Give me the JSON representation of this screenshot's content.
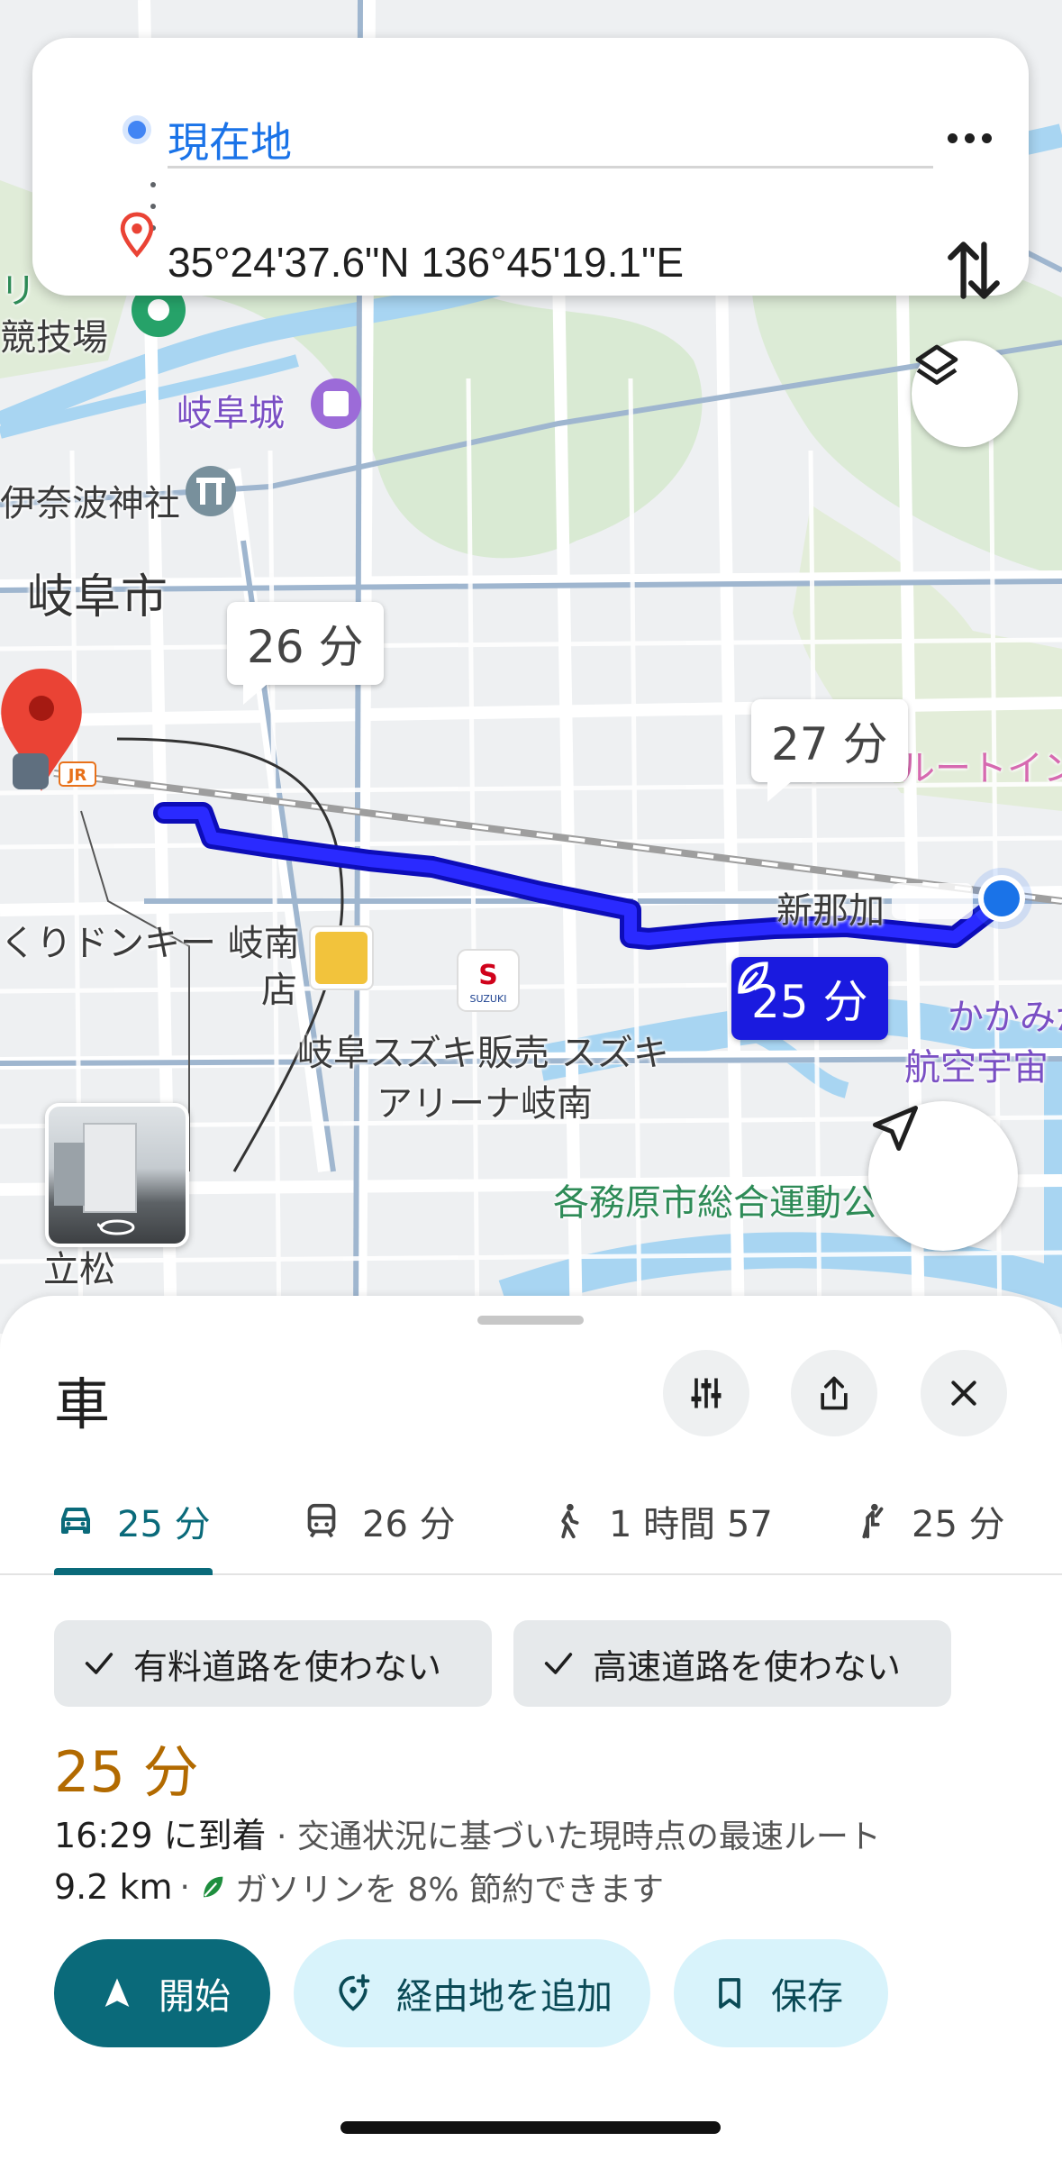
{
  "route_header": {
    "origin": "現在地",
    "destination": "35°24'37.6\"N 136°45'19.1\"E"
  },
  "map": {
    "labels": {
      "stadium": "競技場",
      "stadium_partial": "リ",
      "gifu_castle": "岐阜城",
      "inaba_shrine": "伊奈波神社",
      "gifu_city": "岐阜市",
      "donki": "くりドンキー 岐南",
      "donki_line2": "店",
      "suzuki": "岐阜スズキ販売 スズキ",
      "suzuki_line2": "アリーナ岐南",
      "shin_naka": "新那加",
      "kakamigahara": "かかみが",
      "aerospace": "航空宇宙",
      "route_inn": "ルートイン",
      "sports_park": "各務原市総合運動公",
      "tatematsu": "立松",
      "jr_badge": "JR",
      "suzuki_logo_text": "SUZUKI",
      "donki_logo_text": "びっくりドンキー"
    },
    "bubbles": {
      "alt1": "26 分",
      "alt2": "27 分",
      "selected": "25 分"
    }
  },
  "sheet": {
    "mode_title": "車",
    "tabs": [
      {
        "label": "25 分",
        "icon": "car-icon"
      },
      {
        "label": "26 分",
        "icon": "transit-icon"
      },
      {
        "label": "1 時間 57",
        "icon": "walk-icon"
      },
      {
        "label": "25 分",
        "icon": "ride-icon"
      }
    ],
    "chips": [
      "有料道路を使わない",
      "高速道路を使わない"
    ],
    "eta_minutes": "25 分",
    "arrival": "16:29 に到着",
    "arrival_note": " · 交通状況に基づいた現時点の最速ルート",
    "distance": "9.2 km",
    "distance_sep": " · ",
    "fuel_note": "ガソリンを 8% 節約できます",
    "actions": {
      "start": "開始",
      "add_stop": "経由地を追加",
      "save": "保存"
    }
  },
  "colors": {
    "accent": "#0a6a7a",
    "route": "#1a1adf",
    "eta": "#b26a00",
    "origin": "#4285f4",
    "pin": "#ea4335"
  }
}
